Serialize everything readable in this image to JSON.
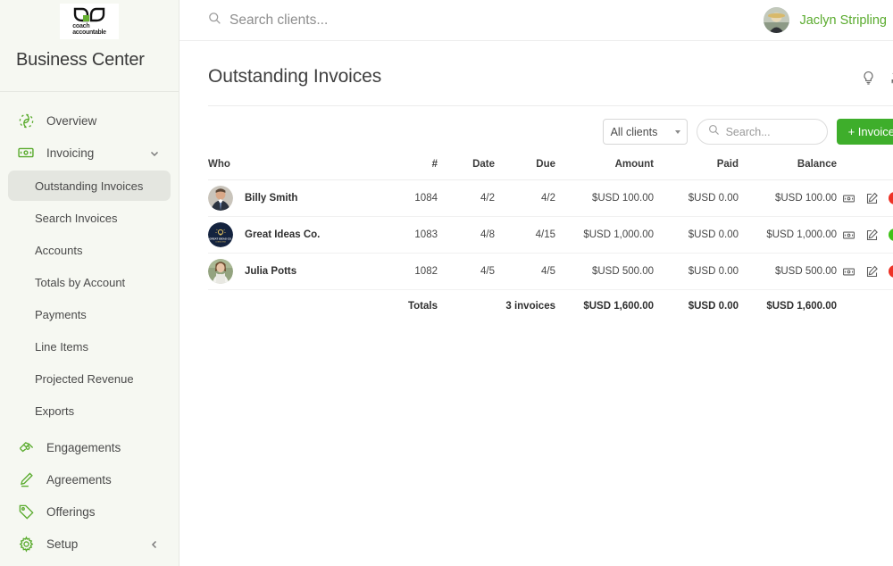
{
  "brand": {
    "logo_line1": "coach",
    "logo_line2": "accountable",
    "logo_icon": "coach-accountable-leaf-logo",
    "accent_green": "#5aab2e",
    "button_green": "#3eae2b",
    "sidebar_bg": "#f6f8f2"
  },
  "sidebar": {
    "title": "Business Center",
    "items": [
      {
        "label": "Overview",
        "icon": "leaf-recycle-icon",
        "expandable": false
      },
      {
        "label": "Invoicing",
        "icon": "money-bill-icon",
        "expandable": true,
        "chevron": "chevron-down-icon"
      }
    ],
    "sub_items": [
      {
        "label": "Outstanding Invoices",
        "active": true
      },
      {
        "label": "Search Invoices",
        "active": false
      },
      {
        "label": "Accounts",
        "active": false
      },
      {
        "label": "Totals by Account",
        "active": false
      },
      {
        "label": "Payments",
        "active": false
      },
      {
        "label": "Line Items",
        "active": false
      },
      {
        "label": "Projected Revenue",
        "active": false
      },
      {
        "label": "Exports",
        "active": false
      }
    ],
    "items_lower": [
      {
        "label": "Engagements",
        "icon": "handshake-icon",
        "expandable": false
      },
      {
        "label": "Agreements",
        "icon": "pen-signature-icon",
        "expandable": false
      },
      {
        "label": "Offerings",
        "icon": "price-tag-icon",
        "expandable": false
      },
      {
        "label": "Setup",
        "icon": "gear-icon",
        "expandable": true,
        "chevron": "chevron-left-icon"
      }
    ]
  },
  "topbar": {
    "search_placeholder": "Search clients...",
    "search_value": "",
    "search_icon": "search-icon",
    "user_name": "Jaclyn Stripling",
    "user_avatar": "user-avatar",
    "user_chevron": "chevron-down-icon"
  },
  "page": {
    "title": "Outstanding Invoices",
    "actions": [
      {
        "icon": "lightbulb-icon",
        "name": "help-tips-button"
      },
      {
        "icon": "refresh-sync-icon",
        "name": "refresh-button"
      }
    ]
  },
  "toolbar": {
    "client_filter_value": "All clients",
    "client_filter_icon": "chevron-down-icon",
    "search_placeholder": "Search...",
    "search_value": "",
    "search_icon": "search-icon",
    "new_invoice_label": "+ Invoice"
  },
  "table": {
    "columns": [
      {
        "key": "who",
        "label": "Who"
      },
      {
        "key": "num",
        "label": "#"
      },
      {
        "key": "date",
        "label": "Date"
      },
      {
        "key": "due",
        "label": "Due"
      },
      {
        "key": "amount",
        "label": "Amount"
      },
      {
        "key": "paid",
        "label": "Paid"
      },
      {
        "key": "balance",
        "label": "Balance"
      },
      {
        "key": "actions",
        "label": ""
      }
    ],
    "rows": [
      {
        "who": "Billy Smith",
        "avatar": "client-avatar-billy-smith",
        "num": "1084",
        "date": "4/2",
        "due": "4/2",
        "amount": "$USD 100.00",
        "paid": "$USD 0.00",
        "balance": "$USD 100.00",
        "status_color": "#ee3226",
        "status_name": "overdue"
      },
      {
        "who": "Great Ideas Co.",
        "avatar": "client-avatar-great-ideas-co",
        "num": "1083",
        "date": "4/8",
        "due": "4/15",
        "amount": "$USD 1,000.00",
        "paid": "$USD 0.00",
        "balance": "$USD 1,000.00",
        "status_color": "#3fc217",
        "status_name": "current"
      },
      {
        "who": "Julia Potts",
        "avatar": "client-avatar-julia-potts",
        "num": "1082",
        "date": "4/5",
        "due": "4/5",
        "amount": "$USD 500.00",
        "paid": "$USD 0.00",
        "balance": "$USD 500.00",
        "status_color": "#ee3226",
        "status_name": "overdue"
      }
    ],
    "row_actions": [
      {
        "icon": "money-bill-icon",
        "name": "record-payment-button"
      },
      {
        "icon": "edit-pencil-icon",
        "name": "edit-invoice-button"
      }
    ],
    "totals": {
      "label": "Totals",
      "count": "3 invoices",
      "amount": "$USD 1,600.00",
      "paid": "$USD 0.00",
      "balance": "$USD 1,600.00"
    }
  }
}
